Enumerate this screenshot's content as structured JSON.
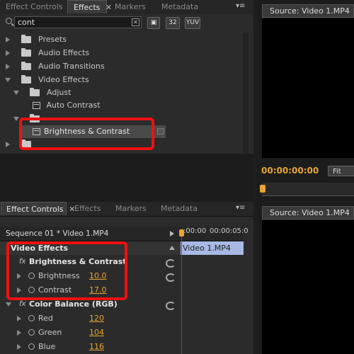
{
  "top_tabs": {
    "effect_controls": "Effect Controls",
    "effects": "Effects",
    "markers": "Markers",
    "metadata": "Metadata"
  },
  "search": {
    "value": "cont"
  },
  "filter_buttons": [
    "32",
    "YUV"
  ],
  "tree": [
    {
      "label": "Presets"
    },
    {
      "label": "Audio Effects"
    },
    {
      "label": "Audio Transitions"
    },
    {
      "label": "Video Effects"
    },
    {
      "label": "Adjust"
    },
    {
      "label": "Auto Contrast"
    },
    {
      "label": "Brightness & Contrast"
    }
  ],
  "source_monitor": {
    "tab": "Source: Video 1.MP4",
    "timecode": "00:00:00:00",
    "fit": "Fit"
  },
  "bottom_tabs": {
    "effect_controls": "Effect Controls",
    "effects": "Effects",
    "markers": "Markers",
    "metadata": "Metadata"
  },
  "effect_controls": {
    "sequence": "Sequence 01 * Video 1.MP4",
    "time_start": ":00:00",
    "time_end": "00:00:05:0",
    "clip": "Video 1.MP4",
    "section": "Video Effects",
    "effects": [
      {
        "name": "Brightness & Contrast",
        "params": [
          {
            "name": "Brightness",
            "value": "10.0"
          },
          {
            "name": "Contrast",
            "value": "17.0"
          }
        ]
      },
      {
        "name": "Color Balance (RGB)",
        "params": [
          {
            "name": "Red",
            "value": "120"
          },
          {
            "name": "Green",
            "value": "104"
          },
          {
            "name": "Blue",
            "value": "116"
          }
        ]
      }
    ]
  },
  "bottom_source_monitor": {
    "tab": "Source: Video 1.MP4"
  },
  "colors": {
    "highlight": "#ee1111",
    "value": "#e8a532",
    "timecode": "#e8a532",
    "clip": "#a9b9e6"
  }
}
